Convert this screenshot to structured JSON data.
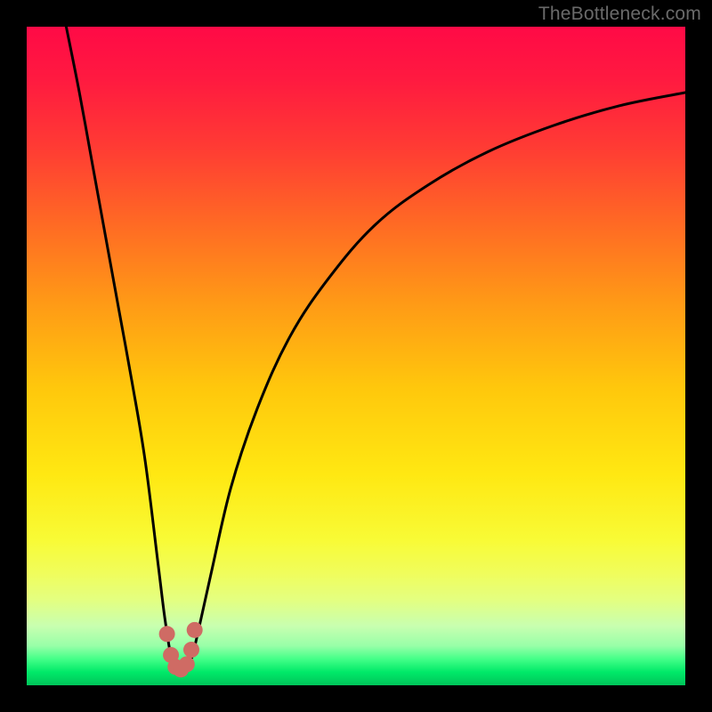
{
  "branding": {
    "watermark": "TheBottleneck.com"
  },
  "colors": {
    "frame": "#000000",
    "curve_stroke": "#000000",
    "marker_fill": "#cf6b64",
    "marker_stroke": "#8c403c",
    "gradient_top": "#ff0a46",
    "gradient_mid": "#ffe812",
    "gradient_bottom": "#00c45a"
  },
  "chart_data": {
    "type": "line",
    "title": "",
    "xlabel": "",
    "ylabel": "",
    "xlim": [
      0,
      100
    ],
    "ylim": [
      0,
      100
    ],
    "note": "V-shaped bottleneck curve. Values estimated from pixel positions; y=100 is top (red/worst), y=0 is bottom (green/best). Minimum near x≈23.",
    "series": [
      {
        "name": "bottleneck-curve",
        "x": [
          6,
          8,
          10,
          12,
          14,
          16,
          18,
          20,
          21,
          22,
          23,
          24,
          25,
          26,
          28,
          31,
          35,
          40,
          46,
          53,
          61,
          70,
          80,
          90,
          100
        ],
        "y": [
          100,
          90,
          79,
          68,
          57,
          46,
          34,
          18,
          10,
          4,
          2,
          2,
          4,
          8,
          17,
          30,
          42,
          53,
          62,
          70,
          76,
          81,
          85,
          88,
          90
        ]
      }
    ],
    "markers": {
      "name": "min-region-dots",
      "x": [
        21.3,
        21.9,
        22.6,
        23.4,
        24.3,
        25.0,
        25.5
      ],
      "y": [
        7.8,
        4.6,
        2.8,
        2.4,
        3.2,
        5.4,
        8.4
      ]
    }
  }
}
